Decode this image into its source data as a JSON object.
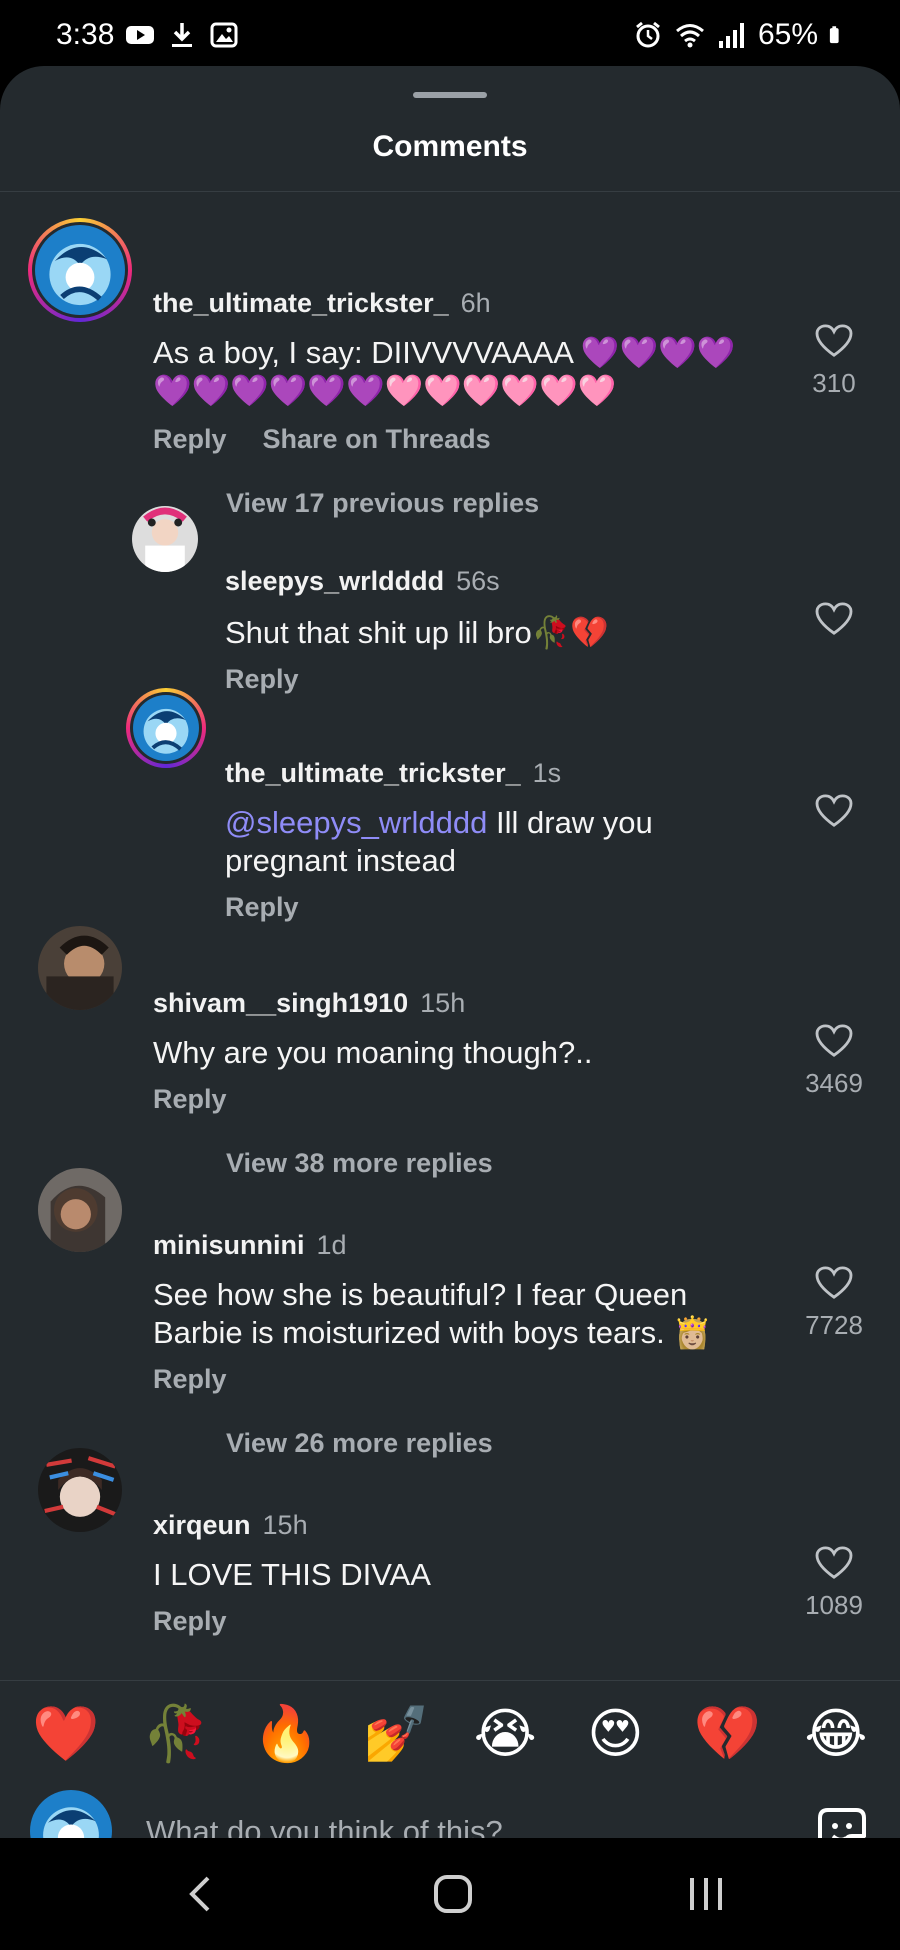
{
  "status_bar": {
    "time": "3:38",
    "battery": "65%"
  },
  "sheet": {
    "title": "Comments"
  },
  "comments": [
    {
      "username": "the_ultimate_trickster_",
      "time": "6h",
      "text_line1": "As a boy, I say: DIIVVVVAAAA 💜💜💜💜",
      "text_line2": "💜💜💜💜💜💜🩷🩷🩷🩷🩷🩷",
      "reply_label": "Reply",
      "share_label": "Share on Threads",
      "likes": "310",
      "view_replies": "View 17 previous replies"
    },
    {
      "username": "sleepys_wrldddd",
      "time": "56s",
      "text": "Shut that shit up lil bro🥀💔",
      "reply_label": "Reply"
    },
    {
      "username": "the_ultimate_trickster_",
      "time": "1s",
      "mention": "@sleepys_wrldddd",
      "text_line1": " Ill draw you",
      "text_line2": "pregnant instead",
      "reply_label": "Reply"
    },
    {
      "username": "shivam__singh1910",
      "time": "15h",
      "text": "Why are you moaning though?..",
      "reply_label": "Reply",
      "likes": "3469",
      "view_replies": "View 38 more replies"
    },
    {
      "username": "minisunnini",
      "time": "1d",
      "text_line1": "See how she is beautiful? I fear Queen",
      "text_line2": "Barbie is moisturized with boys tears. 👸🏼",
      "reply_label": "Reply",
      "likes": "7728",
      "view_replies": "View 26 more replies"
    },
    {
      "username": "xirqeun",
      "time": "15h",
      "text": "I LOVE THIS DIVAA",
      "reply_label": "Reply",
      "likes": "1089"
    }
  ],
  "emoji_bar": [
    "❤️",
    "🥀",
    "🔥",
    "💅",
    "😭",
    "😍",
    "💔",
    "😂"
  ],
  "input": {
    "placeholder": "What do you think of this?"
  },
  "icons": {
    "like": "heart-outline-icon",
    "sticker": "sticker-icon",
    "nav_back": "chevron-left-icon",
    "nav_home": "home-square-icon",
    "nav_recents": "recents-icon"
  }
}
